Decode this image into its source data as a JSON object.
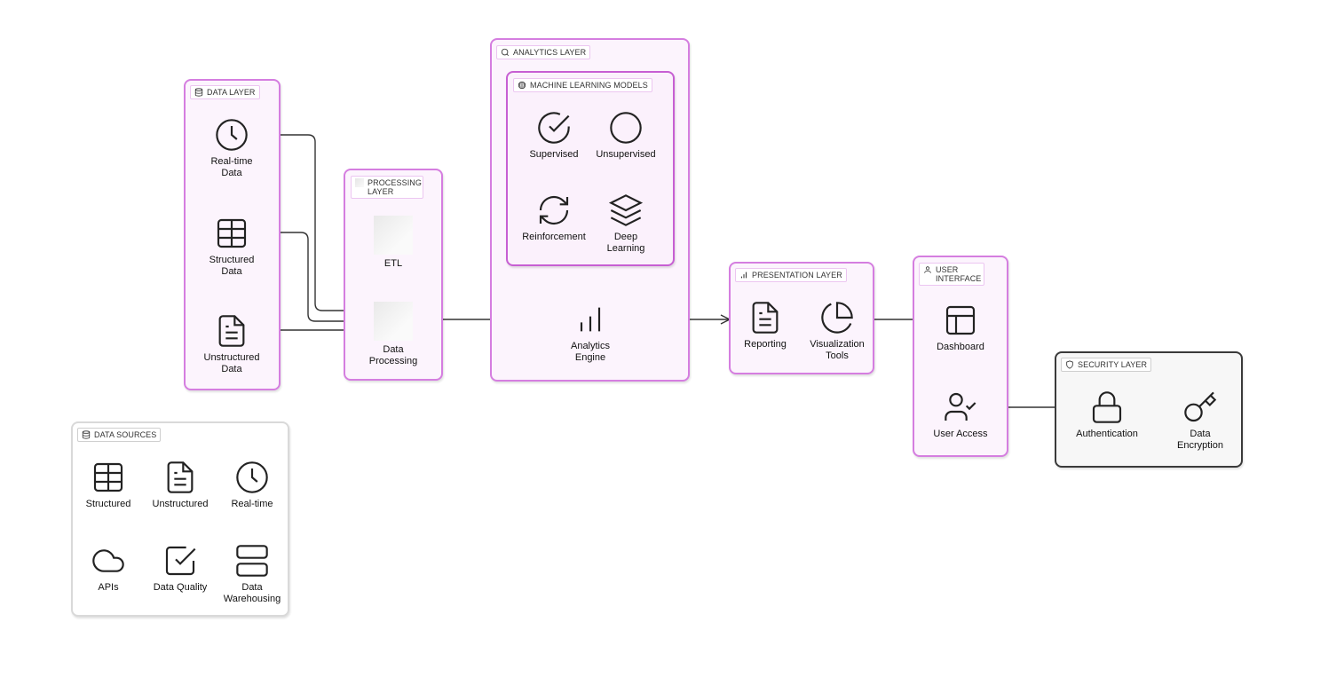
{
  "groups": {
    "data_layer": {
      "title": "DATA LAYER",
      "icon": "database-icon"
    },
    "processing_layer": {
      "title": "PROCESSING LAYER",
      "icon": "placeholder-icon"
    },
    "analytics_layer": {
      "title": "ANALYTICS LAYER",
      "icon": "search-icon"
    },
    "ml_models": {
      "title": "MACHINE LEARNING MODELS",
      "icon": "brain-icon"
    },
    "presentation_layer": {
      "title": "PRESENTATION LAYER",
      "icon": "bar-chart-icon"
    },
    "user_interface": {
      "title": "USER INTERFACE",
      "icon": "user-icon"
    },
    "security_layer": {
      "title": "SECURITY LAYER",
      "icon": "shield-icon"
    },
    "data_sources": {
      "title": "DATA SOURCES",
      "icon": "database-icon"
    }
  },
  "nodes": {
    "realtime_data": {
      "label": "Real-time\nData",
      "icon": "clock-icon"
    },
    "structured_data": {
      "label": "Structured\nData",
      "icon": "table-icon"
    },
    "unstructured_data": {
      "label": "Unstructured\nData",
      "icon": "file-text-icon"
    },
    "etl": {
      "label": "ETL",
      "icon": "placeholder-icon"
    },
    "data_processing": {
      "label": "Data\nProcessing",
      "icon": "placeholder-icon"
    },
    "supervised": {
      "label": "Supervised",
      "icon": "check-circle-icon"
    },
    "unsupervised": {
      "label": "Unsupervised",
      "icon": "circle-icon"
    },
    "reinforcement": {
      "label": "Reinforcement",
      "icon": "refresh-icon"
    },
    "deep_learning": {
      "label": "Deep\nLearning",
      "icon": "layers-icon"
    },
    "analytics_engine": {
      "label": "Analytics\nEngine",
      "icon": "bar-chart-icon"
    },
    "reporting": {
      "label": "Reporting",
      "icon": "file-text-icon"
    },
    "visualization_tools": {
      "label": "Visualization\nTools",
      "icon": "pie-chart-icon"
    },
    "dashboard": {
      "label": "Dashboard",
      "icon": "layout-icon"
    },
    "user_access": {
      "label": "User Access",
      "icon": "user-check-icon"
    },
    "authentication": {
      "label": "Authentication",
      "icon": "lock-icon"
    },
    "data_encryption": {
      "label": "Data\nEncryption",
      "icon": "key-icon"
    },
    "src_structured": {
      "label": "Structured",
      "icon": "table-icon"
    },
    "src_unstructured": {
      "label": "Unstructured",
      "icon": "file-text-icon"
    },
    "src_realtime": {
      "label": "Real-time",
      "icon": "clock-icon"
    },
    "src_apis": {
      "label": "APIs",
      "icon": "cloud-icon"
    },
    "src_data_quality": {
      "label": "Data Quality",
      "icon": "check-square-icon"
    },
    "src_data_warehousing": {
      "label": "Data\nWarehousing",
      "icon": "server-icon"
    }
  },
  "edges": [
    {
      "from": "realtime_data",
      "to": "data_processing"
    },
    {
      "from": "structured_data",
      "to": "data_processing"
    },
    {
      "from": "unstructured_data",
      "to": "data_processing"
    },
    {
      "from": "data_processing",
      "to": "analytics_engine"
    },
    {
      "from": "analytics_engine",
      "to": "reporting"
    },
    {
      "from": "visualization_tools",
      "to": "dashboard"
    },
    {
      "from": "user_access",
      "to": "authentication"
    },
    {
      "from": "authentication",
      "to": "data_encryption"
    }
  ],
  "colors": {
    "layer_border": "#d57ee0",
    "layer_fill": "#fcf4fd",
    "security_border": "#3a3a3a",
    "sources_border": "#d9d9d9",
    "edge": "#333333"
  }
}
